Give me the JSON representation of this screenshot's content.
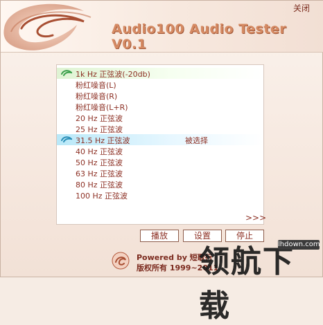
{
  "header": {
    "close_label": "关闭",
    "title": "Audio100 Audio Tester V0.1"
  },
  "list": {
    "items": [
      {
        "label": "1k Hz 正弦波(-20db)",
        "state": "active"
      },
      {
        "label": "粉红噪音(L)",
        "state": ""
      },
      {
        "label": "粉红噪音(R)",
        "state": ""
      },
      {
        "label": "粉红噪音(L+R)",
        "state": ""
      },
      {
        "label": "20 Hz 正弦波",
        "state": ""
      },
      {
        "label": "25 Hz 正弦波",
        "state": ""
      },
      {
        "label": "31.5 Hz 正弦波",
        "state": "selected"
      },
      {
        "label": "40 Hz 正弦波",
        "state": ""
      },
      {
        "label": "50 Hz 正弦波",
        "state": ""
      },
      {
        "label": "63 Hz 正弦波",
        "state": ""
      },
      {
        "label": "80 Hz 正弦波",
        "state": ""
      },
      {
        "label": "100 Hz 正弦波",
        "state": ""
      }
    ],
    "selected_status": "被选择",
    "more_label": ">>>"
  },
  "buttons": {
    "play": "播放",
    "settings": "设置",
    "stop": "停止"
  },
  "footer": {
    "powered_by": "Powered by 短歌行",
    "copyright": "版权所有 1999~2011"
  },
  "watermark": {
    "main": "领航下载",
    "domain": "lhdown.com"
  },
  "colors": {
    "text": "#8c2f23",
    "active_row": "#dff3d3",
    "selected_row": "#b9e8f8",
    "title": "#d58a63"
  },
  "icons": {
    "logo": "swirl-logo-icon",
    "row_indicator": "green-swoosh-icon"
  }
}
